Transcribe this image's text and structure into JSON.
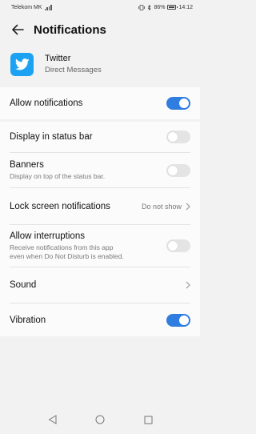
{
  "status_bar": {
    "carrier": "Telekom MK",
    "battery": "86%",
    "time": "14:12"
  },
  "header": {
    "title": "Notifications"
  },
  "app": {
    "name": "Twitter",
    "channel": "Direct Messages",
    "icon": "twitter-bird-icon",
    "icon_color": "#1da1f2"
  },
  "settings": {
    "allow_notifications": {
      "label": "Allow notifications",
      "enabled": true
    },
    "display_status_bar": {
      "label": "Display in status bar",
      "enabled": false
    },
    "banners": {
      "label": "Banners",
      "sub": "Display on top of the status bar.",
      "enabled": false
    },
    "lock_screen": {
      "label": "Lock screen notifications",
      "value": "Do not show"
    },
    "allow_interruptions": {
      "label": "Allow interruptions",
      "sub_line1": "Receive notifications from this app",
      "sub_line2": "even when Do Not Disturb is enabled.",
      "enabled": false
    },
    "sound": {
      "label": "Sound"
    },
    "vibration": {
      "label": "Vibration",
      "enabled": true
    }
  },
  "colors": {
    "accent": "#2f7de0",
    "background": "#f2f2f2"
  }
}
